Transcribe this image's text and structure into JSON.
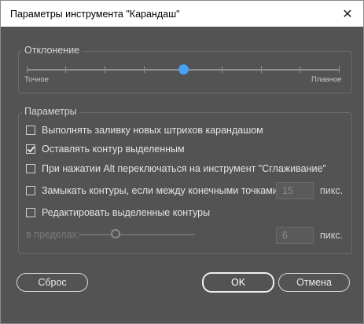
{
  "window": {
    "title": "Параметры инструмента \"Карандаш\"",
    "close_glyph": "✕"
  },
  "deviation": {
    "group_title": "Отклонение",
    "left_label": "Точное",
    "right_label": "Плавное",
    "value_fraction": 0.5
  },
  "params": {
    "group_title": "Параметры",
    "fill_new_strokes": {
      "label": "Выполнять заливку новых штрихов карандашом",
      "checked": false
    },
    "keep_selected": {
      "label": "Оставлять контур выделенным",
      "checked": true
    },
    "alt_smooth": {
      "label": "При нажатии Alt переключаться на инструмент \"Сглаживание\"",
      "checked": false
    },
    "close_paths": {
      "label": "Замыкать контуры, если между конечными точками:",
      "checked": false,
      "value": "15",
      "unit": "пикс."
    },
    "edit_selected": {
      "label": "Редактировать выделенные контуры",
      "checked": false
    },
    "within": {
      "label": "в пределах:",
      "value": "6",
      "unit": "пикс.",
      "slider_fraction": 0.3
    }
  },
  "buttons": {
    "reset": "Сброс",
    "ok": "OK",
    "cancel": "Отмена"
  }
}
